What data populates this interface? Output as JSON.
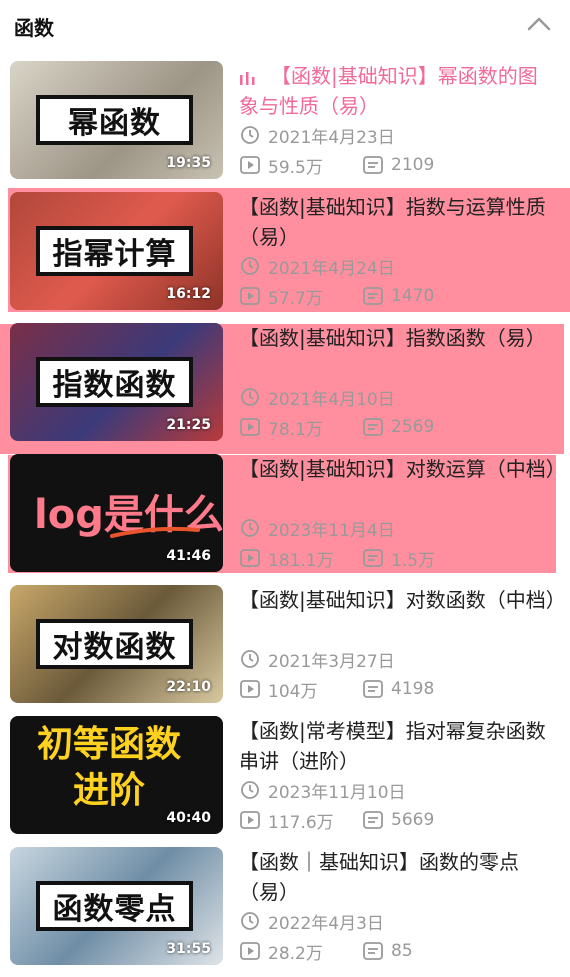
{
  "header": {
    "title": "函数",
    "collapse_icon": "chevron-up-icon"
  },
  "colors": {
    "accent_pink": "#f26a9a",
    "highlight": "#ff6478",
    "meta_gray": "#999999"
  },
  "videos": [
    {
      "thumb_text": "幂函数",
      "duration": "19:35",
      "title": "【函数|基础知识】幂函数的图象与性质（易）",
      "date": "2021年4月23日",
      "plays": "59.5万",
      "danmaku": "2109",
      "playing": true
    },
    {
      "thumb_text": "指幂计算",
      "duration": "16:12",
      "title": "【函数|基础知识】指数与运算性质（易）",
      "date": "2021年4月24日",
      "plays": "57.7万",
      "danmaku": "1470"
    },
    {
      "thumb_text": "指数函数",
      "duration": "21:25",
      "title": "【函数|基础知识】指数函数（易）",
      "date": "2021年4月10日",
      "plays": "78.1万",
      "danmaku": "2569"
    },
    {
      "thumb_text": "log是什么",
      "duration": "41:46",
      "title": "【函数|基础知识】对数运算（中档）",
      "date": "2023年11月4日",
      "plays": "181.1万",
      "danmaku": "1.5万"
    },
    {
      "thumb_text": "对数函数",
      "duration": "22:10",
      "title": "【函数|基础知识】对数函数（中档）",
      "date": "2021年3月27日",
      "plays": "104万",
      "danmaku": "4198"
    },
    {
      "thumb_text": "初等函数进阶",
      "duration": "40:40",
      "title": "【函数|常考模型】指对幂复杂函数串讲（进阶）",
      "date": "2023年11月10日",
      "plays": "117.6万",
      "danmaku": "5669"
    },
    {
      "thumb_text": "函数零点",
      "duration": "31:55",
      "title": "【函数｜基础知识】函数的零点（易）",
      "date": "2022年4月3日",
      "plays": "28.2万",
      "danmaku": "85"
    }
  ]
}
